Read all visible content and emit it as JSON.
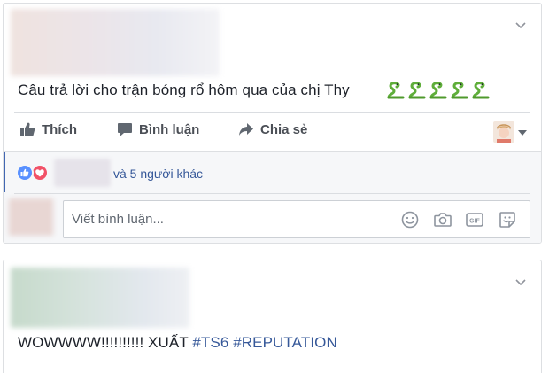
{
  "posts": [
    {
      "text": "Câu trả lời cho trận bóng rổ hôm qua của chị Thy",
      "emojis": [
        "snake",
        "snake",
        "snake",
        "snake",
        "snake"
      ],
      "actions": {
        "like": "Thích",
        "comment": "Bình luận",
        "share": "Chia sẻ"
      },
      "reactions": {
        "types": [
          "like",
          "love"
        ],
        "others_text": "và 5 người khác"
      },
      "comment_placeholder": "Viết bình luận...",
      "comment_icons": [
        "emoji-icon",
        "camera-icon",
        "gif-icon",
        "sticker-icon"
      ]
    },
    {
      "text_plain": "WOWWWW!!!!!!!!!! XUẤT ",
      "hashtags": [
        "#TS6",
        "#REPUTATION"
      ]
    }
  ],
  "colors": {
    "link": "#365899",
    "like_blue": "#5890ff",
    "love_red": "#f25268",
    "action_gray": "#4b4f56",
    "feedback_bg": "#f6f7f9",
    "snake_green": "#5fae3a"
  }
}
